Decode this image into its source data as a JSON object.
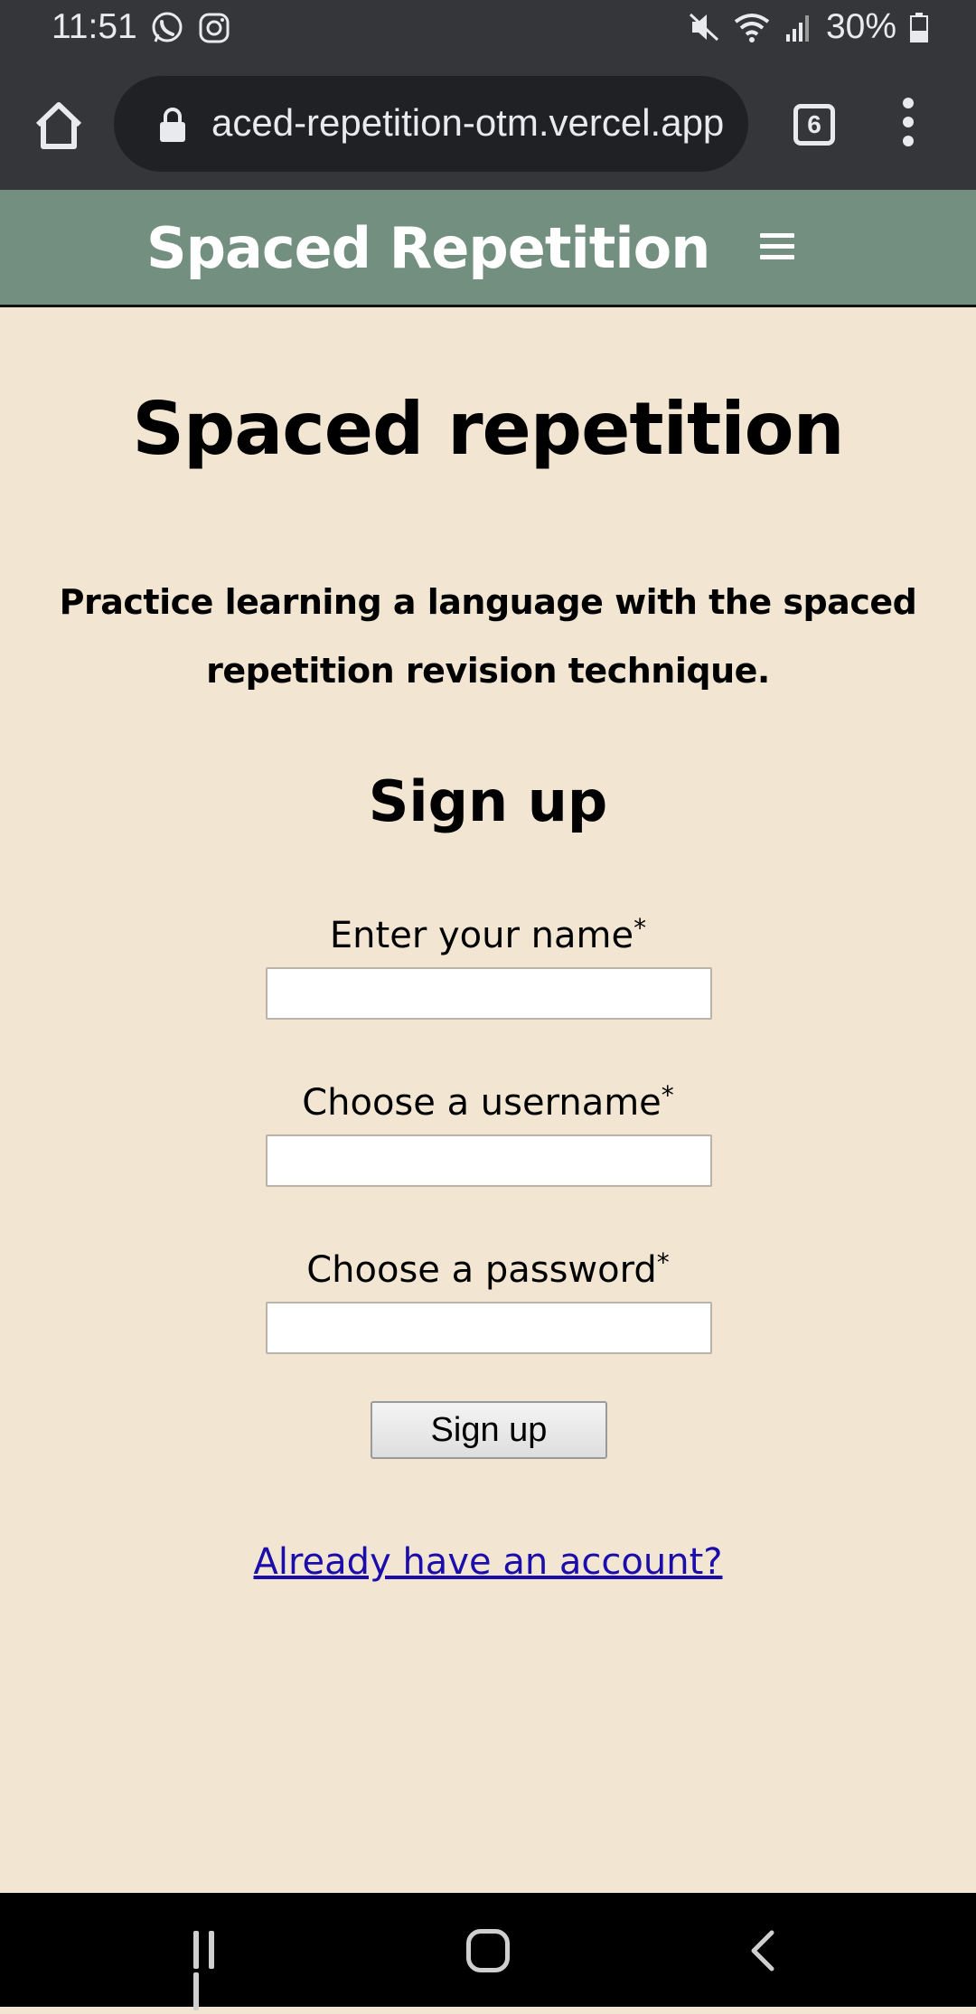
{
  "status_bar": {
    "time": "11:51",
    "battery": "30%",
    "icons": [
      "whatsapp-icon",
      "instagram-icon",
      "mute-icon",
      "wifi-icon",
      "signal-icon",
      "battery-icon"
    ]
  },
  "browser": {
    "url": "aced-repetition-otm.vercel.app",
    "tab_count": "6"
  },
  "site_header": {
    "title": "Spaced Repetition"
  },
  "main": {
    "title": "Spaced repetition",
    "tagline": "Practice learning a language with the spaced repetition revision technique.",
    "form_title": "Sign up",
    "fields": [
      {
        "label": "Enter your name",
        "required_mark": "*",
        "value": ""
      },
      {
        "label": "Choose a username",
        "required_mark": "*",
        "value": ""
      },
      {
        "label": "Choose a password",
        "required_mark": "*",
        "value": ""
      }
    ],
    "submit_label": "Sign up",
    "login_link": "Already have an account?"
  },
  "colors": {
    "header_bg": "#728f80",
    "page_bg": "#f2e6d3",
    "browser_bg": "#35363a",
    "link": "#1a0dab"
  }
}
